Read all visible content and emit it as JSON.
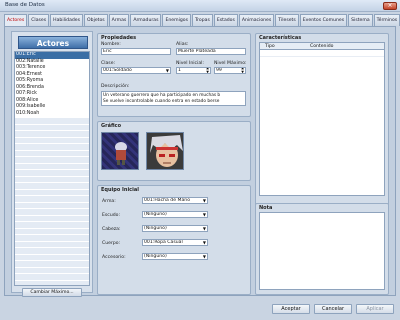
{
  "window": {
    "title": "Base de Datos",
    "close_glyph": "×"
  },
  "tabs": [
    "Actores",
    "Clases",
    "Habilidades",
    "Objetos",
    "Armas",
    "Armaduras",
    "Enemigos",
    "Tropas",
    "Estados",
    "Animaciones",
    "Tilesets",
    "Eventos Comunes",
    "Sistema",
    "Términos"
  ],
  "actors": {
    "header": "Actores",
    "items": [
      "001:Eric",
      "002:Natalie",
      "003:Terence",
      "004:Ernest",
      "005:Ryoma",
      "006:Brenda",
      "007:Rick",
      "008:Alice",
      "009:Isabelle",
      "010:Noah"
    ],
    "selected_index": 0,
    "max_button": "Cambiar Máximo..."
  },
  "properties": {
    "title": "Propiedades",
    "name_label": "Nombre:",
    "name_value": "Eric",
    "nickname_label": "Alias:",
    "nickname_value": "Muerte Plateada",
    "class_label": "Clase:",
    "class_value": "001:Soldado",
    "initial_level_label": "Nivel Inicial:",
    "initial_level_value": "1",
    "max_level_label": "Nivel Máximo:",
    "max_level_value": "99",
    "description_label": "Descripción:",
    "description_lines": [
      "Un veterano guerrero que ha participado en muchas b",
      "Se vuelve incontrolable cuando entra en estado berse"
    ]
  },
  "graphics": {
    "title": "Gráfico"
  },
  "equipment": {
    "title": "Equipo Inicial",
    "rows": [
      {
        "label": "Arma:",
        "value": "001:Hacha de Mano"
      },
      {
        "label": "Escudo:",
        "value": "(Ninguno)"
      },
      {
        "label": "Cabeza:",
        "value": "(Ninguno)"
      },
      {
        "label": "Cuerpo:",
        "value": "001:Ropa Casual"
      },
      {
        "label": "Accesorio:",
        "value": "(Ninguno)"
      }
    ]
  },
  "traits": {
    "title": "Características",
    "col_type": "Tipo",
    "col_content": "Contenido"
  },
  "note": {
    "title": "Nota"
  },
  "footer": {
    "ok": "Aceptar",
    "cancel": "Cancelar",
    "apply": "Aplicar"
  },
  "icons": {
    "dropdown": "▼",
    "spin_up": "▲",
    "spin_down": "▼"
  }
}
